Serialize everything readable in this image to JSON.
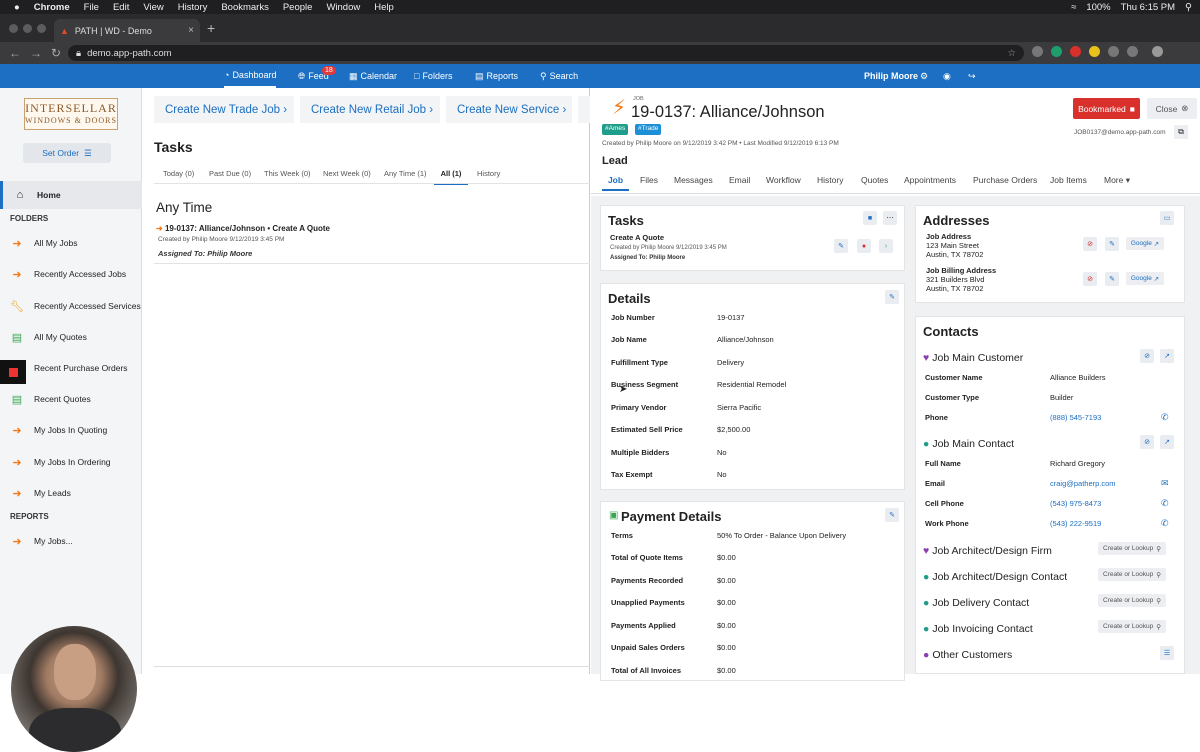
{
  "mac": {
    "menu": [
      "Chrome",
      "File",
      "Edit",
      "View",
      "History",
      "Bookmarks",
      "People",
      "Window",
      "Help"
    ],
    "battery": "100%",
    "clock": "Thu 6:15 PM"
  },
  "browser": {
    "tab_title": "PATH | WD - Demo",
    "url": "demo.app-path.com"
  },
  "appnav": {
    "items": [
      {
        "label": "Dashboard",
        "icon": "dashboard-icon"
      },
      {
        "label": "Feed",
        "icon": "globe-icon",
        "badge": "18"
      },
      {
        "label": "Calendar",
        "icon": "calendar-icon"
      },
      {
        "label": "Folders",
        "icon": "folder-icon"
      },
      {
        "label": "Reports",
        "icon": "chart-icon"
      },
      {
        "label": "Search",
        "icon": "search-icon"
      }
    ],
    "user": "Philip Moore"
  },
  "sidebar": {
    "logo_line1": "INTERSELLAR",
    "logo_line2": "WINDOWS & DOORS",
    "set_order": "Set Order",
    "home": "Home",
    "folders_heading": "FOLDERS",
    "items": [
      {
        "label": "All My Jobs",
        "icon": "bolt-icon"
      },
      {
        "label": "Recently Accessed Jobs",
        "icon": "bolt-icon"
      },
      {
        "label": "Recently Accessed Services",
        "icon": "wrench-icon"
      },
      {
        "label": "All My Quotes",
        "icon": "document-icon"
      },
      {
        "label": "Recent Purchase Orders",
        "icon": "purchase-order-icon"
      },
      {
        "label": "Recent Quotes",
        "icon": "document-icon"
      },
      {
        "label": "My Jobs In Quoting",
        "icon": "bolt-icon"
      },
      {
        "label": "My Jobs In Ordering",
        "icon": "bolt-icon"
      },
      {
        "label": "My Leads",
        "icon": "bolt-icon"
      }
    ],
    "reports_heading": "REPORTS",
    "report_item": "My Jobs..."
  },
  "middle": {
    "create_buttons": [
      "Create New Trade Job",
      "Create New Retail Job",
      "Create New Service"
    ],
    "tasks_title": "Tasks",
    "filters": [
      "Today (0)",
      "Past Due (0)",
      "This Week (0)",
      "Next Week (0)",
      "Any Time (1)",
      "All (1)",
      "History"
    ],
    "section": "Any Time",
    "task": {
      "title": "19-0137: Alliance/Johnson • Create A Quote",
      "meta": "Created by Philip Moore 9/12/2019 3:45 PM",
      "assigned": "Assigned To: Philip Moore"
    }
  },
  "job": {
    "label": "JOB",
    "title": "19-0137: Alliance/Johnson",
    "tags": [
      "#Ames",
      "#Trade"
    ],
    "meta": "Created by Philip Moore on 9/12/2019 3:42 PM • Last Modified 9/12/2019 6:13 PM",
    "status": "Lead",
    "bookmarked": "Bookmarked",
    "close": "Close",
    "email": "JOB0137@demo.app-path.com",
    "tabs": [
      "Job",
      "Files",
      "Messages",
      "Email",
      "Workflow",
      "History",
      "Quotes",
      "Appointments",
      "Purchase Orders",
      "Job Items",
      "More"
    ],
    "tasks_card": {
      "title": "Tasks",
      "task_title": "Create A Quote",
      "task_meta": "Created by Philip Moore 9/12/2019 3:45 PM",
      "task_assigned": "Assigned To: Philip Moore"
    },
    "details": {
      "title": "Details",
      "rows": [
        {
          "k": "Job Number",
          "v": "19-0137"
        },
        {
          "k": "Job Name",
          "v": "Alliance/Johnson"
        },
        {
          "k": "Fulfillment Type",
          "v": "Delivery"
        },
        {
          "k": "Business Segment",
          "v": "Residential Remodel"
        },
        {
          "k": "Primary Vendor",
          "v": "Sierra Pacific"
        },
        {
          "k": "Estimated Sell Price",
          "v": "$2,500.00"
        },
        {
          "k": "Multiple Bidders",
          "v": "No"
        },
        {
          "k": "Tax Exempt",
          "v": "No"
        }
      ]
    },
    "payment": {
      "title": "Payment Details",
      "rows": [
        {
          "k": "Terms",
          "v": "50% To Order - Balance Upon Delivery"
        },
        {
          "k": "Total of Quote Items",
          "v": "$0.00"
        },
        {
          "k": "Payments Recorded",
          "v": "$0.00"
        },
        {
          "k": "Unapplied Payments",
          "v": "$0.00"
        },
        {
          "k": "Payments Applied",
          "v": "$0.00"
        },
        {
          "k": "Unpaid Sales Orders",
          "v": "$0.00"
        },
        {
          "k": "Total of All Invoices",
          "v": "$0.00"
        }
      ]
    },
    "addresses": {
      "title": "Addresses",
      "job_label": "Job Address",
      "job_line1": "123 Main Street",
      "job_line2": "Austin, TX 78702",
      "billing_label": "Job Billing Address",
      "billing_line1": "321 Builders Blvd",
      "billing_line2": "Austin, TX 78702",
      "google": "Google"
    },
    "contacts": {
      "title": "Contacts",
      "main_customer": "Job Main Customer",
      "customer_rows": [
        {
          "k": "Customer Name",
          "v": "Alliance Builders"
        },
        {
          "k": "Customer Type",
          "v": "Builder"
        },
        {
          "k": "Phone",
          "v": "(888) 545-7193"
        }
      ],
      "main_contact": "Job Main Contact",
      "contact_rows": [
        {
          "k": "Full Name",
          "v": "Richard Gregory"
        },
        {
          "k": "Email",
          "v": "craig@patherp.com"
        },
        {
          "k": "Cell Phone",
          "v": "(543) 975-8473"
        },
        {
          "k": "Work Phone",
          "v": "(543) 222-9519"
        }
      ],
      "others": [
        "Job Architect/Design Firm",
        "Job Architect/Design Contact",
        "Job Delivery Contact",
        "Job Invoicing Contact",
        "Other Customers"
      ],
      "lookup": "Create or Lookup"
    }
  },
  "colors": {
    "accent": "#1c6fc2",
    "danger": "#d9302c",
    "brand_orange": "#f07a1a"
  }
}
